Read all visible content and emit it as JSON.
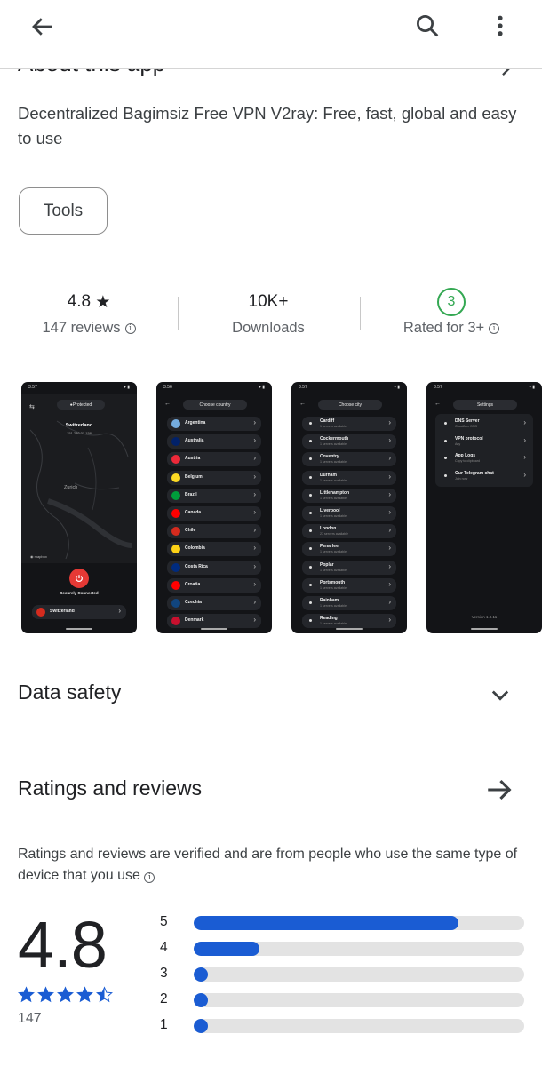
{
  "header": {
    "back_icon": "arrow-left-icon",
    "search_icon": "search-icon",
    "more_icon": "more-vert-icon",
    "about_peek": "About this app"
  },
  "description": "Decentralized Bagimsiz Free VPN V2ray: Free, fast, global and easy to use",
  "category_chip": "Tools",
  "stats": {
    "rating_value": "4.8",
    "rating_label": "147 reviews",
    "downloads_value": "10K+",
    "downloads_label": "Downloads",
    "content_rating_value": "3",
    "content_rating_label": "Rated for 3+"
  },
  "screenshots": {
    "s1": {
      "time": "3:57",
      "pill": "Protected",
      "country_title": "Switzerland",
      "ip": "151.236.21.158",
      "map_city": "Zurich",
      "map_credit": "mapbox",
      "status": "Securely Connected",
      "selected": "Switzerland"
    },
    "s2": {
      "time": "3:56",
      "pill": "Choose country",
      "countries": [
        "Argentina",
        "Australia",
        "Austria",
        "Belgium",
        "Brazil",
        "Canada",
        "Chile",
        "Colombia",
        "Costa Rica",
        "Croatia",
        "Czechia",
        "Denmark"
      ]
    },
    "s3": {
      "time": "3:57",
      "pill": "Choose city",
      "cities": [
        {
          "name": "Cardiff",
          "sub": "1 servers available"
        },
        {
          "name": "Cockermouth",
          "sub": "1 servers available"
        },
        {
          "name": "Coventry",
          "sub": "1 servers available"
        },
        {
          "name": "Durham",
          "sub": "1 servers available"
        },
        {
          "name": "Littlehampton",
          "sub": "1 servers available"
        },
        {
          "name": "Liverpool",
          "sub": "1 servers available"
        },
        {
          "name": "London",
          "sub": "27 servers available"
        },
        {
          "name": "Penarlee",
          "sub": "1 servers available"
        },
        {
          "name": "Poplar",
          "sub": "1 servers available"
        },
        {
          "name": "Portsmouth",
          "sub": "1 servers available"
        },
        {
          "name": "Rainham",
          "sub": "1 servers available"
        },
        {
          "name": "Reading",
          "sub": "1 servers available"
        }
      ]
    },
    "s4": {
      "time": "3:57",
      "pill": "Settings",
      "items": [
        {
          "name": "DNS Server",
          "sub": "Cloudflare DNS"
        },
        {
          "name": "VPN protocol",
          "sub": "Any"
        },
        {
          "name": "App Logs",
          "sub": "Copy to clipboard"
        },
        {
          "name": "Our Telegram chat",
          "sub": "Join now"
        }
      ],
      "version": "Version 1.0.11"
    }
  },
  "data_safety": {
    "title": "Data safety",
    "icon": "chevron-down-icon"
  },
  "ratings": {
    "title": "Ratings and reviews",
    "arrow_icon": "arrow-right-icon",
    "note": "Ratings and reviews are verified and are from people who use the same type of device that you use",
    "score": "4.8",
    "count": "147",
    "stars_value": 4.5,
    "bars": [
      {
        "label": "5",
        "fraction": 0.8
      },
      {
        "label": "4",
        "fraction": 0.2
      },
      {
        "label": "3",
        "fraction": 0.04
      },
      {
        "label": "2",
        "fraction": 0.04
      },
      {
        "label": "1",
        "fraction": 0.04
      }
    ]
  },
  "colors": {
    "accent_blue": "#1a5cd3",
    "rating_green": "#34a853",
    "vpn_red": "#e53935"
  }
}
